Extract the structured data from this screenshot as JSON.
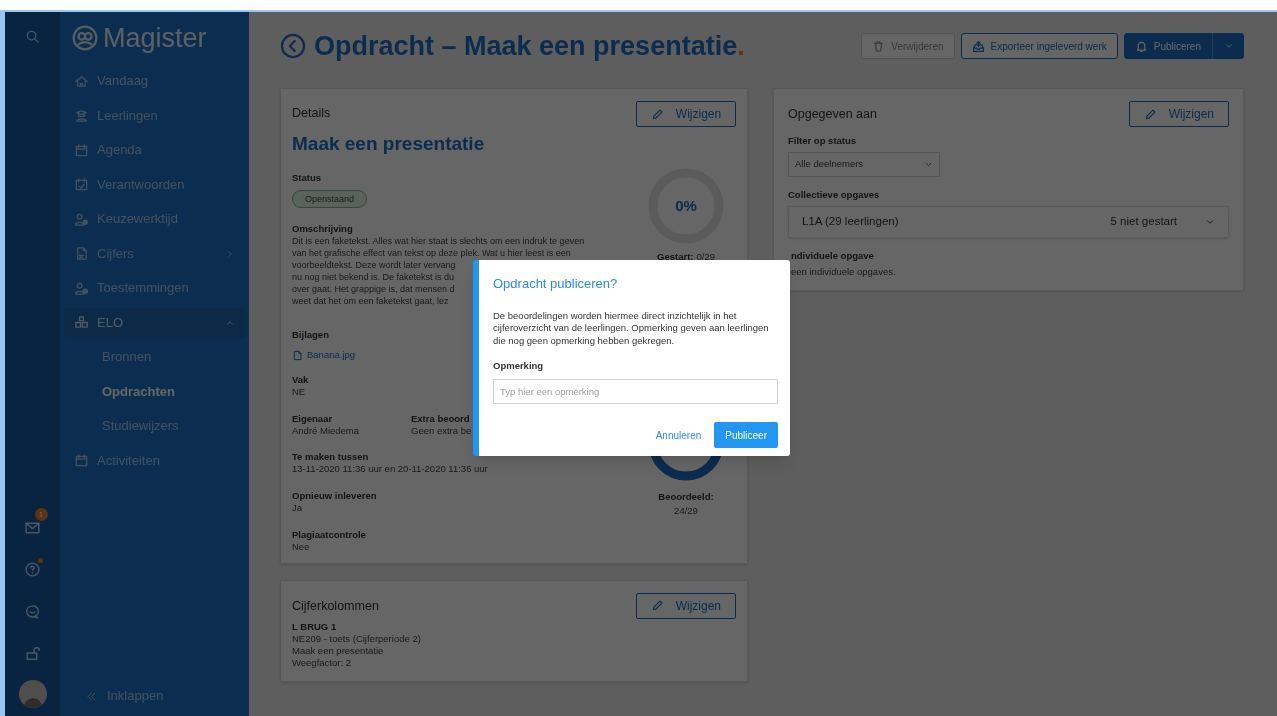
{
  "sidebar": {
    "brand": "Magister",
    "nav": [
      {
        "label": "Vandaag",
        "selected": false
      },
      {
        "label": "Leerlingen",
        "selected": false
      },
      {
        "label": "Agenda",
        "selected": false
      },
      {
        "label": "Verantwoorden",
        "selected": false
      },
      {
        "label": "Keuzewerktijd",
        "selected": false
      },
      {
        "label": "Cijfers",
        "selected": false,
        "expanded": false
      },
      {
        "label": "Toestemmingen",
        "selected": false
      },
      {
        "label": "ELO",
        "selected": false,
        "expanded": true,
        "children": [
          {
            "label": "Bronnen",
            "selected": false
          },
          {
            "label": "Opdrachten",
            "selected": true
          },
          {
            "label": "Studiewijzers",
            "selected": false
          }
        ]
      },
      {
        "label": "Activiteiten",
        "selected": false
      }
    ],
    "bottom_icons": [
      {
        "badge": "1",
        "dot": false
      },
      {
        "dot": true
      },
      {
        "dot": false
      },
      {
        "dot": false
      }
    ],
    "collapse": "Inklappen"
  },
  "header": {
    "title": "Opdracht – Maak een presentatie",
    "title_dot": ".",
    "buttons": [
      {
        "label": "Verwijderen",
        "kind": "delete",
        "disabled": true
      },
      {
        "label": "Exporteer ingeleverd werk",
        "kind": "export",
        "disabled": false
      },
      {
        "label": "Publiceren",
        "kind": "primary",
        "disabled": false
      }
    ]
  },
  "details": {
    "heading": "Details",
    "edit": "Wijzigen",
    "name": "Maak een presentatie",
    "status_label": "Status",
    "status": "Openstaand",
    "description_label": "Omschrijving",
    "description_lines": [
      "Dit is een faketekst. Alles wat hier staat is slechts om een indruk te geven",
      "van het grafische effect van tekst op deze plek. Wat u hier leest is een",
      "voorbeeldtekst. Deze wordt later vervang",
      "nu nog niet bekend is. De faketekst is du",
      "over gaat. Het grappige is, dat mensen d",
      "weet dat het om een faketekst gaat, lez"
    ],
    "attachments_label": "Bijlagen",
    "attachment": "Banana.jpg",
    "subject_label": "Vak",
    "subject": "NE",
    "owner_label": "Eigenaar",
    "owner": "André Miedema",
    "extra_label": "Extra beoord",
    "extra": "Geen extra be",
    "period_label": "Te maken tussen",
    "period": "13-11-2020 11:36 uur en 20-11-2020 11:36 uur",
    "resubmit_label": "Opnieuw inleveren",
    "resubmit": "Ja",
    "plagiarism_label": "Plagiaatcontrole",
    "plagiarism": "Nee",
    "progress": [
      {
        "percent": "0%",
        "level": 0,
        "caption": "Gestart:",
        "count": "0/29"
      },
      {
        "caption": "Beoordeeld:",
        "count": "24/29"
      }
    ]
  },
  "assigned": {
    "heading": "Opgegeven aan",
    "edit": "Wijzigen",
    "filter_label": "Filter op status",
    "filter_value": "Alle deelnemers",
    "collective_label": "Collectieve opgaves",
    "group": "L1A (29 leerlingen)",
    "group_status": "5 niet gestart",
    "individual_label": "ndividuele opgave",
    "individual": "een individuele opgaves."
  },
  "grade_columns": {
    "heading": "Cijferkolommen",
    "edit": "Wijzigen",
    "title": "L BRUG 1",
    "lines": [
      "NE209 - toets (Cijferperiode 2)",
      "Maak een presentatie",
      "Weegfactor: 2"
    ]
  },
  "dialog": {
    "title": "Opdracht publiceren?",
    "text": "De beoordelingen worden hiermee direct inzichtelijk in het cijferoverzicht van de leerlingen. Opmerking geven aan leerlingen die nog geen opmerking hebben gekregen.",
    "field_label": "Opmerking",
    "placeholder": "Typ hier een opmerking",
    "cancel": "Annuleren",
    "confirm": "Publiceer"
  }
}
